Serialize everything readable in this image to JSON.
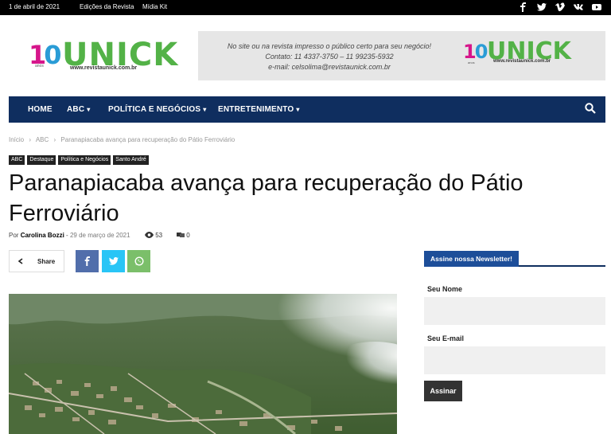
{
  "topbar": {
    "date": "1 de abril de 2021",
    "links": [
      "Edições da Revista",
      "Mídia Kit"
    ],
    "social_icons": [
      "facebook-icon",
      "twitter-icon",
      "vimeo-icon",
      "vk-icon",
      "youtube-icon"
    ]
  },
  "logo": {
    "number_1": "1",
    "number_0": "0",
    "anos": "anos",
    "word": "UNICK",
    "url": "www.revistaunick.com.br"
  },
  "banner": {
    "line1": "No site ou na revista impresso o público certo para seu negócio!",
    "line2": "Contato: 11 4337-3750 – 11 99235-5932",
    "line3": "e-mail: celsolima@revistaunick.com.br",
    "logo_word": "UNICK",
    "logo_url": "www.revistaunick.com.br",
    "logo_anos": "anos"
  },
  "nav": {
    "items": [
      "HOME",
      "ABC",
      "POLÍTICA E NEGÓCIOS",
      "ENTRETENIMENTO"
    ],
    "chevron": "⌄"
  },
  "breadcrumb": {
    "items": [
      "Início",
      "ABC",
      "Paranapiacaba avança para recuperação do Pátio Ferroviário"
    ],
    "separator": "›"
  },
  "tags": [
    "ABC",
    "Destaque",
    "Política e Negócios",
    "Santo André"
  ],
  "article": {
    "title": "Paranapiacaba avança para recuperação do Pátio Ferroviário",
    "by": "Por",
    "author": "Carolina Bozzi",
    "dash": "-",
    "date": "29 de março de 2021",
    "views": "53",
    "comments": "0"
  },
  "share": {
    "label": "Share",
    "facebook": "f",
    "twitter": "t",
    "whatsapp": "w"
  },
  "newsletter": {
    "title": "Assine nossa Newsletter!",
    "name_label": "Seu Nome",
    "email_label": "Seu E-mail",
    "button": "Assinar"
  },
  "colors": {
    "nav_bg": "#0f2e5f",
    "accent_blue": "#1d4e99",
    "logo_green": "#53b247",
    "logo_pink": "#d6168b",
    "logo_blue": "#2a9cd6",
    "facebook": "#516eab",
    "twitter": "#29c5f6",
    "whatsapp": "#7bbf6a"
  }
}
